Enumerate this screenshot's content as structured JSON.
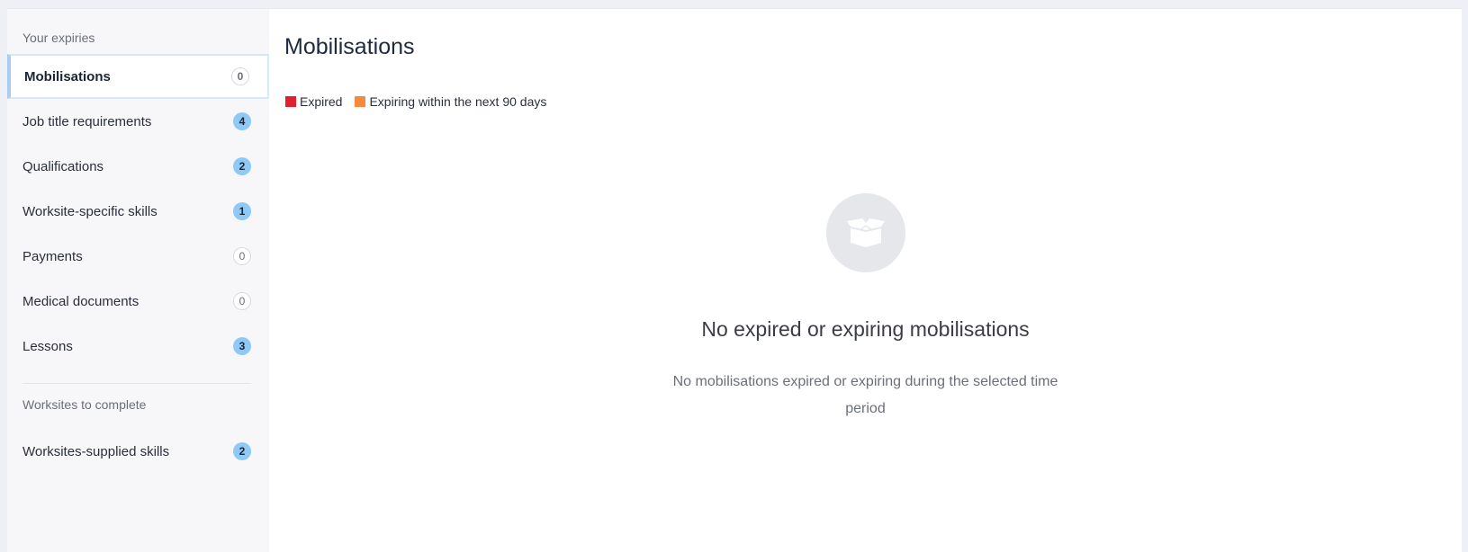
{
  "sidebar": {
    "section1_label": "Your expiries",
    "items": [
      {
        "label": "Mobilisations",
        "count": "0"
      },
      {
        "label": "Job title requirements",
        "count": "4"
      },
      {
        "label": "Qualifications",
        "count": "2"
      },
      {
        "label": "Worksite-specific skills",
        "count": "1"
      },
      {
        "label": "Payments",
        "count": "0"
      },
      {
        "label": "Medical documents",
        "count": "0"
      },
      {
        "label": "Lessons",
        "count": "3"
      }
    ],
    "section2_label": "Worksites to complete",
    "items2": [
      {
        "label": "Worksites-supplied skills",
        "count": "2"
      }
    ]
  },
  "main": {
    "title": "Mobilisations",
    "legend": [
      {
        "label": "Expired",
        "color": "#e0202e"
      },
      {
        "label": "Expiring within the next 90 days",
        "color": "#f58a3c"
      }
    ],
    "empty_icon": "open-box-icon",
    "empty_title": "No expired or expiring mobilisations",
    "empty_text": "No mobilisations expired or expiring during the selected time period"
  }
}
